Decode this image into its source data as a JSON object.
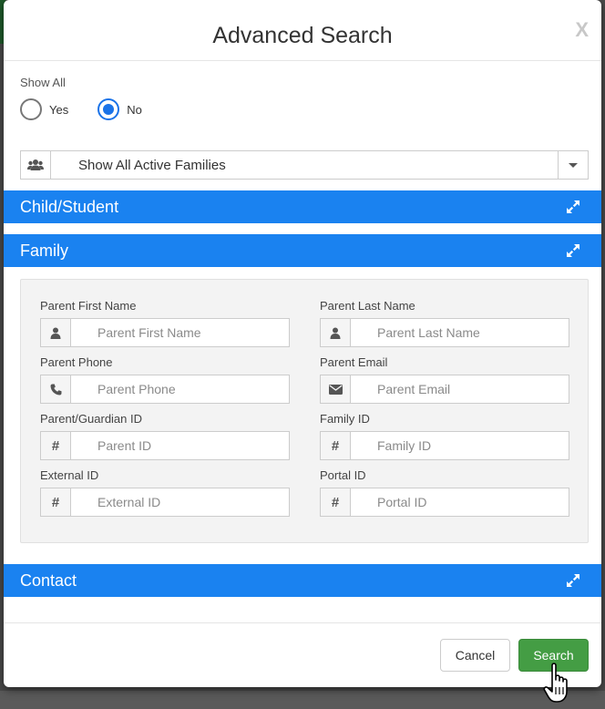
{
  "modal": {
    "title": "Advanced Search",
    "close_label": "X"
  },
  "show_all": {
    "label": "Show All",
    "options": [
      {
        "label": "Yes",
        "checked": false
      },
      {
        "label": "No",
        "checked": true
      }
    ]
  },
  "family_filter": {
    "selected": "Show All Active Families",
    "icon": "users-icon"
  },
  "sections": {
    "child_student": "Child/Student",
    "family": "Family",
    "contact": "Contact"
  },
  "family_fields": [
    {
      "label": "Parent First Name",
      "placeholder": "Parent First Name",
      "icon": "user-icon",
      "value": ""
    },
    {
      "label": "Parent Last Name",
      "placeholder": "Parent Last Name",
      "icon": "user-icon",
      "value": ""
    },
    {
      "label": "Parent Phone",
      "placeholder": "Parent Phone",
      "icon": "phone-icon",
      "value": ""
    },
    {
      "label": "Parent Email",
      "placeholder": "Parent Email",
      "icon": "envelope-icon",
      "value": ""
    },
    {
      "label": "Parent/Guardian ID",
      "placeholder": "Parent ID",
      "icon": "hash-icon",
      "value": ""
    },
    {
      "label": "Family ID",
      "placeholder": "Family ID",
      "icon": "hash-icon",
      "value": ""
    },
    {
      "label": "External ID",
      "placeholder": "External ID",
      "icon": "hash-icon",
      "value": ""
    },
    {
      "label": "Portal ID",
      "placeholder": "Portal ID",
      "icon": "hash-icon",
      "value": ""
    }
  ],
  "hash_symbol": "#",
  "footer": {
    "cancel_label": "Cancel",
    "search_label": "Search"
  },
  "colors": {
    "section_bar": "#1a82f0",
    "search_button": "#449d44",
    "radio_checked": "#1a73e8"
  }
}
